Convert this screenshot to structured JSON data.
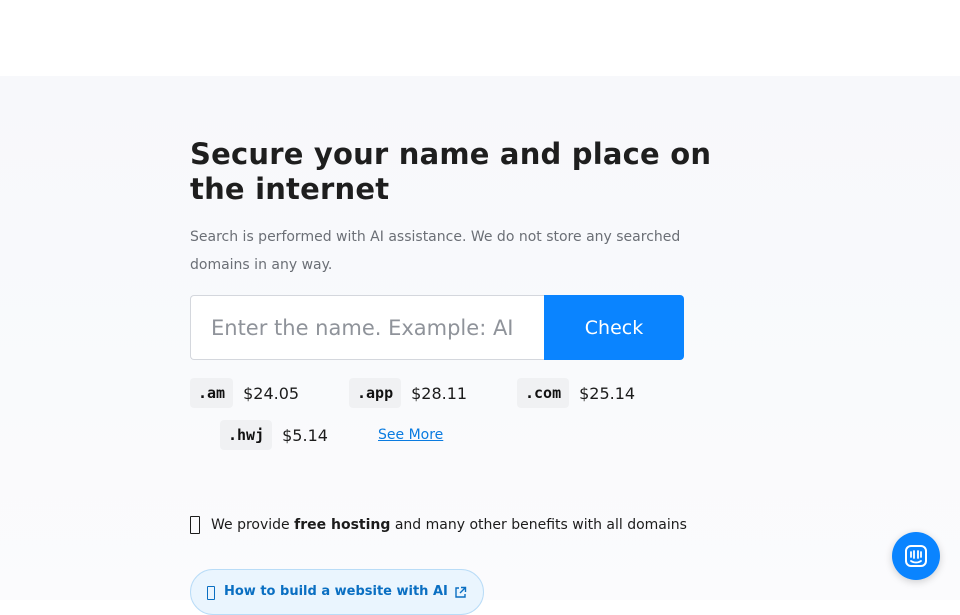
{
  "hero": {
    "title": "Secure your name and place on the internet",
    "subtitle": "Search is performed with AI assistance. We do not store any searched domains in any way."
  },
  "search": {
    "placeholder": "Enter the name. Example: AI",
    "value": "",
    "button_label": "Check"
  },
  "tlds": [
    {
      "name": ".am",
      "price": "$24.05"
    },
    {
      "name": ".app",
      "price": "$28.11"
    },
    {
      "name": ".com",
      "price": "$25.14"
    },
    {
      "name": ".hwj",
      "price": "$5.14"
    }
  ],
  "see_more_label": "See More",
  "hosting": {
    "prefix": "We provide ",
    "bold": "free hosting",
    "suffix": " and many other benefits with all domains",
    "icon": "gift-icon"
  },
  "ai_link": {
    "label": "How to build a website with AI",
    "icon": "lightbulb-icon",
    "external_icon": "external-link-icon"
  },
  "chat": {
    "icon": "chat-icon"
  },
  "colors": {
    "accent": "#0a84ff",
    "link": "#0a7be0",
    "pill_bg": "#eaf5fe",
    "pill_border": "#b9dcf7"
  }
}
